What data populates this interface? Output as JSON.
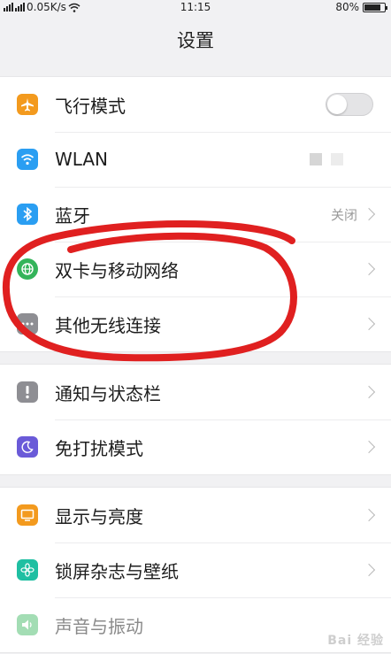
{
  "status_bar": {
    "network_speed": "0.05K/s",
    "time": "11:15",
    "battery": "80%",
    "battery_level": 0.8
  },
  "title": "设置",
  "sections": [
    {
      "rows": [
        {
          "label": "飞行模式",
          "icon": "airplane-icon",
          "color": "#f39a1e",
          "toggle_on": false
        },
        {
          "label": "WLAN",
          "icon": "wifi-icon",
          "color": "#2a9ef2"
        },
        {
          "label": "蓝牙",
          "icon": "bluetooth-icon",
          "color": "#2a9ef2",
          "value": "关闭"
        },
        {
          "label": "双卡与移动网络",
          "icon": "globe-icon",
          "color": "#34b45a"
        },
        {
          "label": "其他无线连接",
          "icon": "more-icon",
          "color": "#8e8e93"
        }
      ]
    },
    {
      "rows": [
        {
          "label": "通知与状态栏",
          "icon": "exclamation-icon",
          "color": "#8e8e93"
        },
        {
          "label": "免打扰模式",
          "icon": "moon-icon",
          "color": "#6a5ad8"
        }
      ]
    },
    {
      "rows": [
        {
          "label": "显示与亮度",
          "icon": "display-icon",
          "color": "#f39a1e"
        },
        {
          "label": "锁屏杂志与壁纸",
          "icon": "flower-icon",
          "color": "#1fbfa2"
        },
        {
          "label": "声音与振动",
          "icon": "speaker-icon",
          "color": "#34b45a"
        }
      ]
    }
  ],
  "annotation_color": "#e02020",
  "watermark": "Bai 经验"
}
